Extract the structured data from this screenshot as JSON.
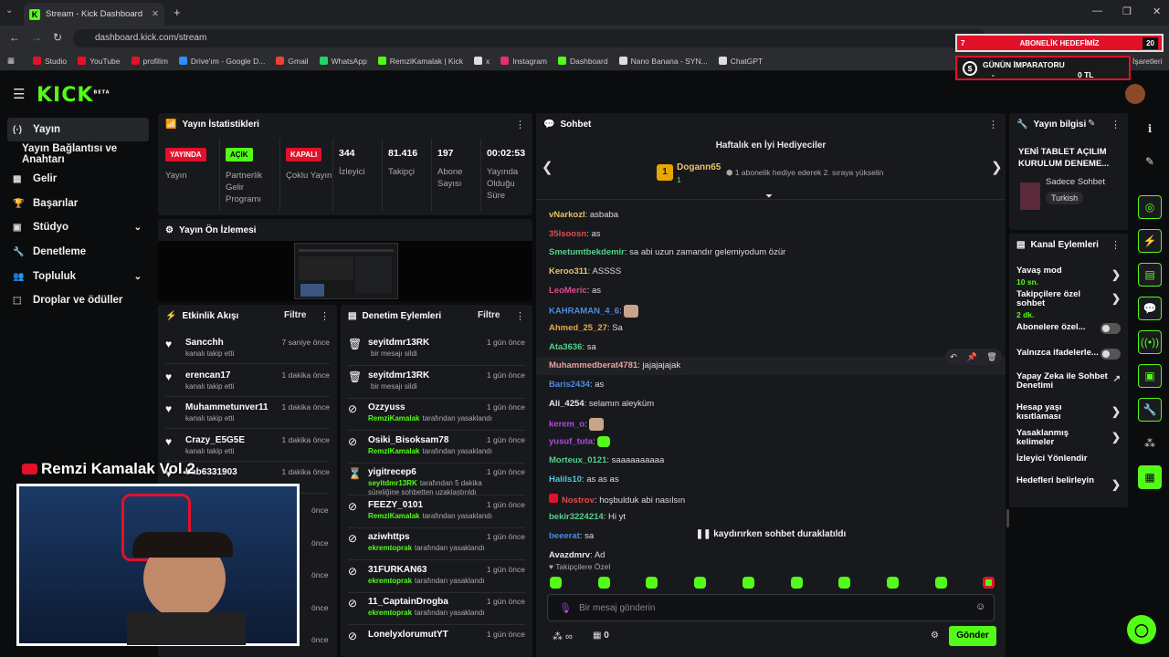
{
  "browser": {
    "tab_title": "Stream - Kick Dashboard",
    "url": "dashboard.kick.com/stream",
    "bookmarks": [
      "Studio",
      "YouTube",
      "profilim",
      "Drive'ım - Google D...",
      "Gmail",
      "WhatsApp",
      "RemziKamalak | Kick",
      "x",
      "Instagram",
      "Dashboard",
      "Nano Banana - SYN...",
      "ChatGPT"
    ],
    "bookmarks_more": "İşaretleri"
  },
  "overlay": {
    "sub_goal_left": "7",
    "sub_goal_label": "ABONELİK HEDEFİMİZ",
    "sub_goal_right": "20",
    "emperor_label": "GÜNÜN İMPARATORU",
    "emperor_name": "-",
    "emperor_amount": "0 TL",
    "channel_name": "Remzi Kamalak Vol.2"
  },
  "brand": {
    "logo": "KICK",
    "beta": "BETA"
  },
  "nav": [
    {
      "label": "Yayın",
      "icon": "broadcast-icon"
    },
    {
      "label": "Yayın Bağlantısı ve Anahtarı"
    },
    {
      "label": "Gelir",
      "icon": "revenue-icon"
    },
    {
      "label": "Başarılar",
      "icon": "achievements-icon"
    },
    {
      "label": "Stüdyo",
      "icon": "studio-icon"
    },
    {
      "label": "Denetleme",
      "icon": "wrench-icon"
    },
    {
      "label": "Topluluk",
      "icon": "community-icon"
    },
    {
      "label": "Droplar ve ödüller",
      "icon": "gift-icon"
    }
  ],
  "stats": {
    "title": "Yayın İstatistikleri",
    "items": [
      {
        "badge": "YAYINDA",
        "label": "Yayın"
      },
      {
        "badge": "AÇIK",
        "label": "Partnerlik Gelir Programı"
      },
      {
        "badge": "KAPALI",
        "label": "Çoklu Yayın"
      },
      {
        "value": "344",
        "label": "İzleyici"
      },
      {
        "value": "81.416",
        "label": "Takipçi"
      },
      {
        "value": "197",
        "label": "Abone Sayısı"
      },
      {
        "value": "00:02:53",
        "label": "Yayında Olduğu Süre"
      }
    ]
  },
  "preview": {
    "title": "Yayın Ön İzlemesi"
  },
  "activity": {
    "title": "Etkinlik Akışı",
    "filter": "Filtre",
    "items": [
      {
        "name": "Sancchh",
        "sub": "kanalı takip etti",
        "time": "7 saniye önce"
      },
      {
        "name": "erencan17",
        "sub": "kanalı takip etti",
        "time": "1 dakika önce"
      },
      {
        "name": "Muhammetunver11",
        "sub": "kanalı takip etti",
        "time": "1 dakika önce"
      },
      {
        "name": "Crazy_E5G5E",
        "sub": "kanalı takip etti",
        "time": "1 dakika önce"
      },
      {
        "name": "bab6331903",
        "sub": "",
        "time": "1 dakika önce"
      }
    ],
    "extra_times": [
      "önce",
      "önce",
      "önce",
      "önce",
      "önce"
    ]
  },
  "modlog": {
    "title": "Denetim Eylemleri",
    "filter": "Filtre",
    "items": [
      {
        "name": "seyitdmr13RK",
        "sub": "bir mesajı sildi",
        "time": "1 gün önce",
        "icon": "trash-icon"
      },
      {
        "name": "seyitdmr13RK",
        "sub": "bir mesajı sildi",
        "time": "1 gün önce",
        "icon": "trash-icon"
      },
      {
        "name": "Ozzyuss",
        "mod": "RemziKamalak",
        "sub": "tarafından yasaklandı",
        "time": "1 gün önce",
        "icon": "ban-icon"
      },
      {
        "name": "Osiki_Bisoksam78",
        "mod": "RemziKamalak",
        "sub": "tarafından yasaklandı",
        "time": "1 gün önce",
        "icon": "ban-icon"
      },
      {
        "name": "yigitrecep6",
        "mod": "seyitdmr13RK",
        "sub": "tarafından 5 dakika süreliğine sohbetten uzaklaştırıldı",
        "time": "1 gün önce",
        "icon": "hourglass-icon"
      },
      {
        "name": "FEEZY_0101",
        "mod": "RemziKamalak",
        "sub": "tarafından yasaklandı",
        "time": "1 gün önce",
        "icon": "ban-icon"
      },
      {
        "name": "aziwhttps",
        "mod": "ekremtoprak",
        "sub": "tarafından yasaklandı",
        "time": "1 gün önce",
        "icon": "ban-icon"
      },
      {
        "name": "31FURKAN63",
        "mod": "ekremtoprak",
        "sub": "tarafından yasaklandı",
        "time": "1 gün önce",
        "icon": "ban-icon"
      },
      {
        "name": "11_CaptainDrogba",
        "mod": "ekremtoprak",
        "sub": "tarafından yasaklandı",
        "time": "1 gün önce",
        "icon": "ban-icon"
      },
      {
        "name": "LonelyxlorumutYT",
        "mod": "",
        "sub": "",
        "time": "1 gün önce",
        "icon": "ban-icon"
      }
    ]
  },
  "chat": {
    "title": "Sohbet",
    "gifters_title": "Haftalık en İyi Hediyeciler",
    "top_rank": "1",
    "top_name": "Dogann65",
    "top_count": "1",
    "top_note": "1 abonelik hediye ederek 2. sıraya yükselin",
    "messages": [
      {
        "user": "vNarkozl",
        "text": "asbaba",
        "color": "#e8c26a"
      },
      {
        "user": "35lsoosn",
        "text": "as",
        "color": "#e04b4b"
      },
      {
        "user": "Smetumtbekdemir",
        "text": "sa abi uzun zamandır gelemiyodum özür",
        "color": "#53d18c"
      },
      {
        "user": "Keroo311",
        "text": "ASSSS",
        "color": "#e8c26a"
      },
      {
        "user": "LeoMeric",
        "text": "as",
        "color": "#e04b8b"
      },
      {
        "user": "KAHRAMAN_4_6",
        "text": "",
        "color": "#4b8be0"
      },
      {
        "user": "Ahmed_25_27",
        "text": "Sa",
        "color": "#e8a84b"
      },
      {
        "user": "Ata3636",
        "text": "sa",
        "color": "#53d18c"
      },
      {
        "user": "Muhammedberat4781",
        "text": "jajajajajak",
        "color": "#e8a0a0"
      },
      {
        "user": "Baris2434",
        "text": "as",
        "color": "#4b8be0"
      },
      {
        "user": "Ali_4254",
        "text": "selamın aleyküm",
        "color": "#e8e8e8"
      },
      {
        "user": "kerem_o",
        "text": "",
        "color": "#b04be0"
      },
      {
        "user": "yusuf_tuta",
        "text": "",
        "color": "#b04be0"
      },
      {
        "user": "Morteux_0121",
        "text": "saaaaaaaaaa",
        "color": "#53d18c"
      },
      {
        "user": "Halils10",
        "text": "as as as",
        "color": "#4bc8e0"
      },
      {
        "user": "Nostrov",
        "text": "hoşbulduk abi nasılsın",
        "color": "#e04b4b"
      },
      {
        "user": "bekir3224214",
        "text": "Hi yt",
        "color": "#53d18c"
      },
      {
        "user": "beeerat",
        "text": "sa",
        "color": "#4b8be0"
      },
      {
        "user": "Avazdmrv",
        "text": "Ad",
        "color": "#e8e8e8"
      }
    ],
    "paused": "kaydırırken sohbet duraklatıldı",
    "followers_only": "Takipçilere Özel",
    "input_placeholder": "Bir mesaj gönderin",
    "send_label": "Gönder",
    "points": "0"
  },
  "stream_info": {
    "title": "Yayın bilgisi",
    "stream_title": "YENİ TABLET AÇILIM KURULUM DENEME...",
    "category": "Sadece Sohbet",
    "language": "Turkish"
  },
  "channel_actions": {
    "title": "Kanal Eylemleri",
    "items": [
      {
        "label": "Yavaş mod",
        "sub": "10 sn.",
        "kind": "chevron"
      },
      {
        "label": "Takipçilere özel sohbet",
        "sub": "2 dk.",
        "kind": "chevron"
      },
      {
        "label": "Abonelere özel...",
        "kind": "toggle"
      },
      {
        "label": "Yalnızca ifadelerle...",
        "kind": "toggle"
      },
      {
        "label": "Yapay Zeka ile Sohbet Denetimi",
        "kind": "external"
      },
      {
        "label": "Hesap yaşı kısıtlaması",
        "kind": "chevron"
      },
      {
        "label": "Yasaklanmış kelimeler",
        "kind": "chevron"
      },
      {
        "label": "İzleyici Yönlendir",
        "kind": "none"
      },
      {
        "label": "Hedefleri belirleyin",
        "kind": "chevron"
      }
    ]
  },
  "colors": {
    "brand": "#53fc18",
    "live": "#e3102a",
    "panel": "#18191c",
    "background": "#0b0c0d"
  }
}
